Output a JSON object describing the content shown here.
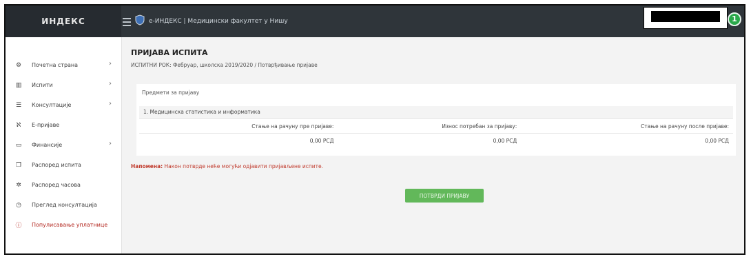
{
  "topbar": {
    "brand": "ИНДЕКС",
    "breadcrumb": "e-ИНДЕКС | Медицински факултет у Нишу"
  },
  "user": {
    "avatar_initial": "1"
  },
  "sidebar": {
    "items": [
      {
        "label": "Почетна страна",
        "icon": "gear-icon",
        "has_arrow": true
      },
      {
        "label": "Испити",
        "icon": "chart-icon",
        "has_arrow": true
      },
      {
        "label": "Консултације",
        "icon": "list-icon",
        "has_arrow": true
      },
      {
        "label": "Е-пријаве",
        "icon": "users-icon",
        "has_arrow": false
      },
      {
        "label": "Финансије",
        "icon": "folder-icon",
        "has_arrow": true
      },
      {
        "label": "Распоред испита",
        "icon": "calendar-icon",
        "has_arrow": false
      },
      {
        "label": "Распоред часова",
        "icon": "settings-icon",
        "has_arrow": false
      },
      {
        "label": "Преглед консултација",
        "icon": "clock-icon",
        "has_arrow": false
      },
      {
        "label": "Популисавање уплатнице",
        "icon": "info-icon",
        "has_arrow": false,
        "alert": true
      }
    ]
  },
  "main": {
    "title": "ПРИЈАВА ИСПИТА",
    "subtitle": "ИСПИТНИ РОК: Фебруар, школска 2019/2020 / Потврђивање пријаве",
    "card": {
      "header": "Предмети за пријаву",
      "item": "1. Медицинска статистика и информатика",
      "columns": [
        "Стање на рачуну пре пријаве:",
        "Износ потребан за пријаву:",
        "Стање на рачуну после пријаве:"
      ],
      "values": [
        "0,00 РСД",
        "0,00 РСД",
        "0,00 РСД"
      ]
    },
    "note_label": "Напомена:",
    "note_text": " Након потврде неће могући одјавити пријављене испите.",
    "confirm_button": "ПОТВРДИ ПРИЈАВУ"
  }
}
